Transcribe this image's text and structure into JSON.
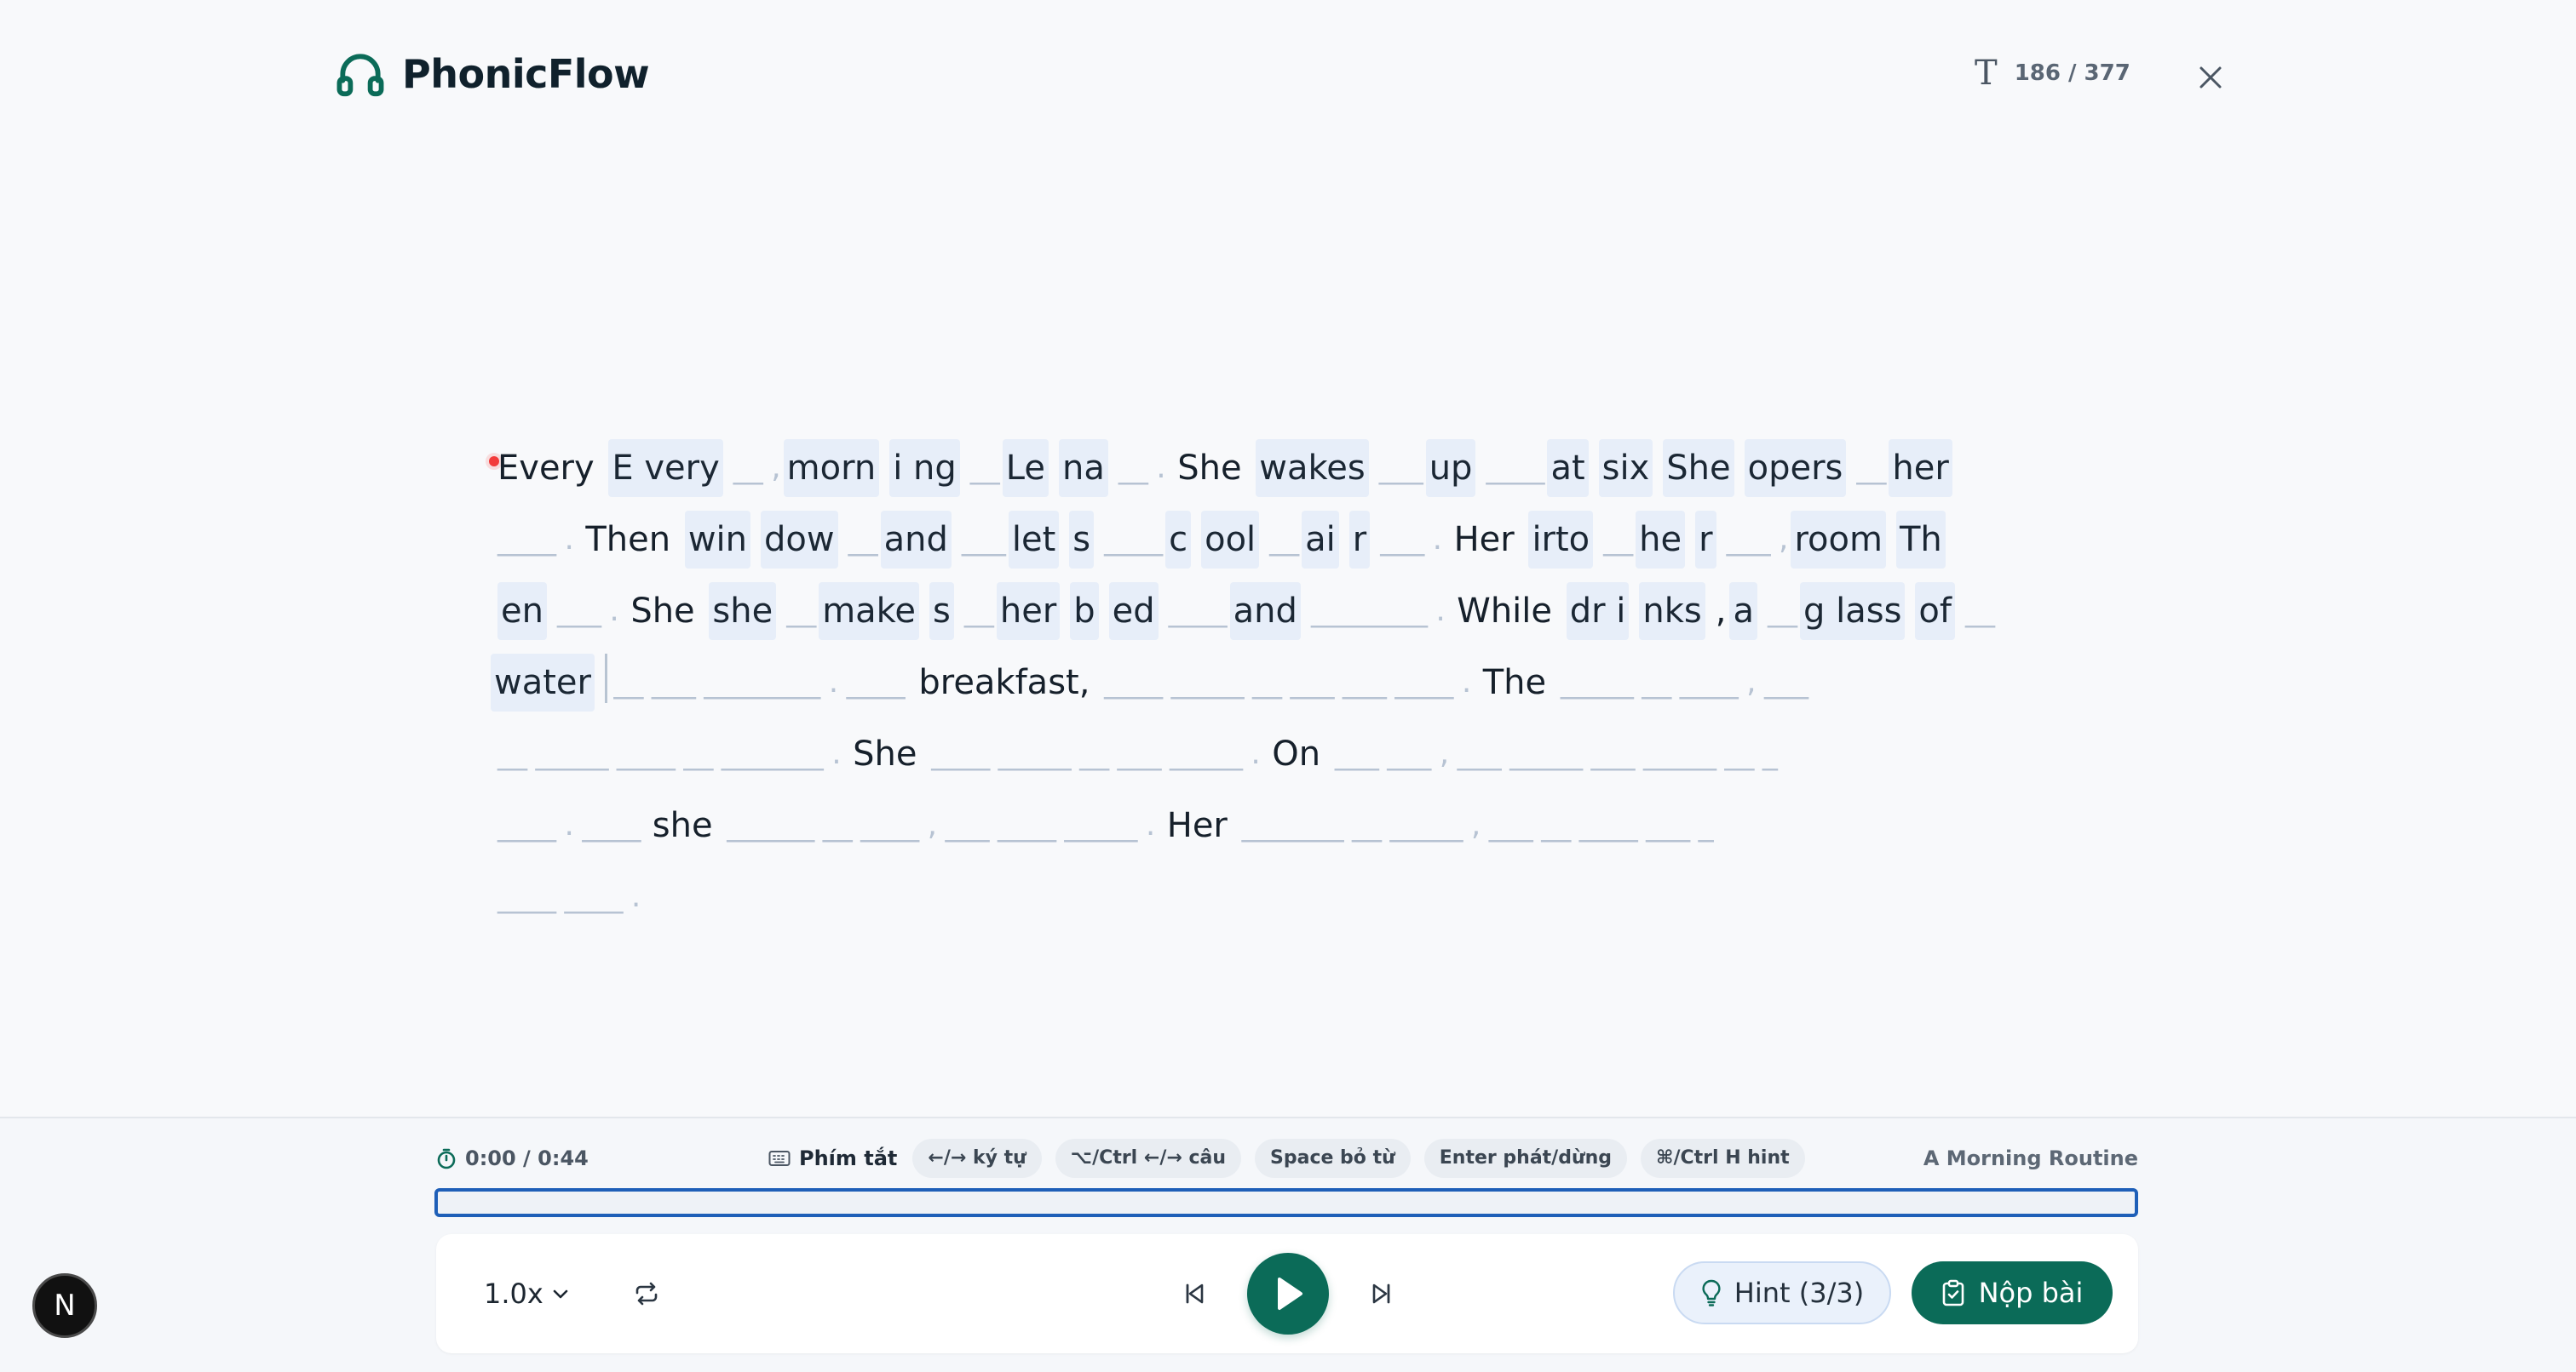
{
  "header": {
    "brand": "PhonicFlow",
    "counter": "186 / 377",
    "counter_icon": "text-size-icon",
    "close_icon": "close-icon"
  },
  "dictation": {
    "lines": [
      [
        {
          "t": "Every ",
          "k": "txt"
        },
        {
          "t": "E very",
          "k": "hl"
        },
        {
          "t": "__ ,",
          "k": "blank"
        },
        {
          "t": "morn",
          "k": "hl"
        },
        {
          "t": "i ng",
          "k": "hl"
        },
        {
          "t": "__",
          "k": "blank"
        },
        {
          "t": "Le",
          "k": "hl"
        },
        {
          "t": "na",
          "k": "hl"
        },
        {
          "t": "__ . ",
          "k": "blank"
        },
        {
          "t": "She ",
          "k": "txt"
        },
        {
          "t": "wakes",
          "k": "hl"
        },
        {
          "t": "___",
          "k": "blank"
        },
        {
          "t": "up",
          "k": "hl"
        },
        {
          "t": "____",
          "k": "blank"
        },
        {
          "t": "at",
          "k": "hl"
        },
        {
          "t": "six",
          "k": "hl"
        },
        {
          "t": "She",
          "k": "hl"
        },
        {
          "t": "opers",
          "k": "hl"
        },
        {
          "t": "__",
          "k": "blank"
        },
        {
          "t": "her",
          "k": "hl"
        }
      ],
      [
        {
          "t": "____ . ",
          "k": "blank"
        },
        {
          "t": "Then ",
          "k": "txt"
        },
        {
          "t": "win",
          "k": "hl"
        },
        {
          "t": "dow",
          "k": "hl"
        },
        {
          "t": "__",
          "k": "blank"
        },
        {
          "t": "and",
          "k": "hl"
        },
        {
          "t": "___",
          "k": "blank"
        },
        {
          "t": "let",
          "k": "hl"
        },
        {
          "t": "s",
          "k": "hl"
        },
        {
          "t": "____",
          "k": "blank"
        },
        {
          "t": "c",
          "k": "hl"
        },
        {
          "t": "ool",
          "k": "hl"
        },
        {
          "t": "__",
          "k": "blank"
        },
        {
          "t": "ai",
          "k": "hl"
        },
        {
          "t": "r",
          "k": "hl"
        },
        {
          "t": "___ . ",
          "k": "blank"
        },
        {
          "t": "Her ",
          "k": "txt"
        },
        {
          "t": "irto",
          "k": "hl"
        },
        {
          "t": "__",
          "k": "blank"
        },
        {
          "t": "he",
          "k": "hl"
        },
        {
          "t": "r",
          "k": "hl"
        },
        {
          "t": "___ ,",
          "k": "blank"
        },
        {
          "t": "room",
          "k": "hl"
        },
        {
          "t": "Th",
          "k": "hl"
        }
      ],
      [
        {
          "t": "en",
          "k": "hl"
        },
        {
          "t": "___ . ",
          "k": "blank"
        },
        {
          "t": "She ",
          "k": "txt"
        },
        {
          "t": "she",
          "k": "hl"
        },
        {
          "t": "__",
          "k": "blank"
        },
        {
          "t": "make",
          "k": "hl"
        },
        {
          "t": "s",
          "k": "hl"
        },
        {
          "t": "__",
          "k": "blank"
        },
        {
          "t": "her",
          "k": "hl"
        },
        {
          "t": "b",
          "k": "hl"
        },
        {
          "t": "ed",
          "k": "hl"
        },
        {
          "t": "____",
          "k": "blank"
        },
        {
          "t": "and",
          "k": "hl"
        },
        {
          "t": "________ . ",
          "k": "blank"
        },
        {
          "t": "While ",
          "k": "txt"
        },
        {
          "t": "dr i",
          "k": "hl"
        },
        {
          "t": "nks",
          "k": "hl"
        },
        {
          "t": ",",
          "k": "txt"
        },
        {
          "t": "a",
          "k": "hl"
        },
        {
          "t": "__",
          "k": "blank"
        },
        {
          "t": "g lass",
          "k": "hl"
        },
        {
          "t": "of",
          "k": "hl"
        },
        {
          "t": "__",
          "k": "blank"
        }
      ],
      [
        {
          "t": "water",
          "k": "hl"
        },
        {
          "t": " __ ___ ________ . ____",
          "k": "blank"
        },
        {
          "t": " breakfast, ",
          "k": "txt"
        },
        {
          "t": "____ _____ __ ___ ___ ____ . ",
          "k": "blank"
        },
        {
          "t": "The ",
          "k": "txt"
        },
        {
          "t": "_____ __ ____ , ___",
          "k": "blank"
        }
      ],
      [
        {
          "t": "__ _____ ____ __ _______ . ",
          "k": "blank"
        },
        {
          "t": "She ",
          "k": "txt"
        },
        {
          "t": "____ _____ __ ___ _____ . ",
          "k": "blank"
        },
        {
          "t": "On ",
          "k": "txt"
        },
        {
          "t": "___ ___ , ___ _____ ___ _____ __ _",
          "k": "blank"
        }
      ],
      [
        {
          "t": "____ . ____ ",
          "k": "blank"
        },
        {
          "t": "she ",
          "k": "txt"
        },
        {
          "t": "______ __ ____ , ___ ____ _____ . ",
          "k": "blank"
        },
        {
          "t": "Her ",
          "k": "txt"
        },
        {
          "t": "_______ __ _____ , ___ __ ____ ___ _",
          "k": "blank"
        }
      ],
      [
        {
          "t": "____ ____ .",
          "k": "blank"
        }
      ]
    ]
  },
  "player": {
    "time": "0:00 / 0:44",
    "progress": 0,
    "shortcuts_label": "Phím tắt",
    "shortcuts": [
      "←/→ ký tự",
      "⌥/Ctrl ←/→ câu",
      "Space bỏ từ",
      "Enter phát/dừng",
      "⌘/Ctrl H hint"
    ],
    "lesson_title": "A Morning Routine",
    "speed": "1.0x",
    "hint_label": "Hint (3/3)",
    "submit_label": "Nộp bài",
    "badge": "N"
  },
  "colors": {
    "accent": "#0b6b58",
    "progress_border": "#1e5fb8",
    "highlight": "#e7eef9",
    "blank_text": "#b7c3d3",
    "hint_bg": "#eaf1fb"
  }
}
